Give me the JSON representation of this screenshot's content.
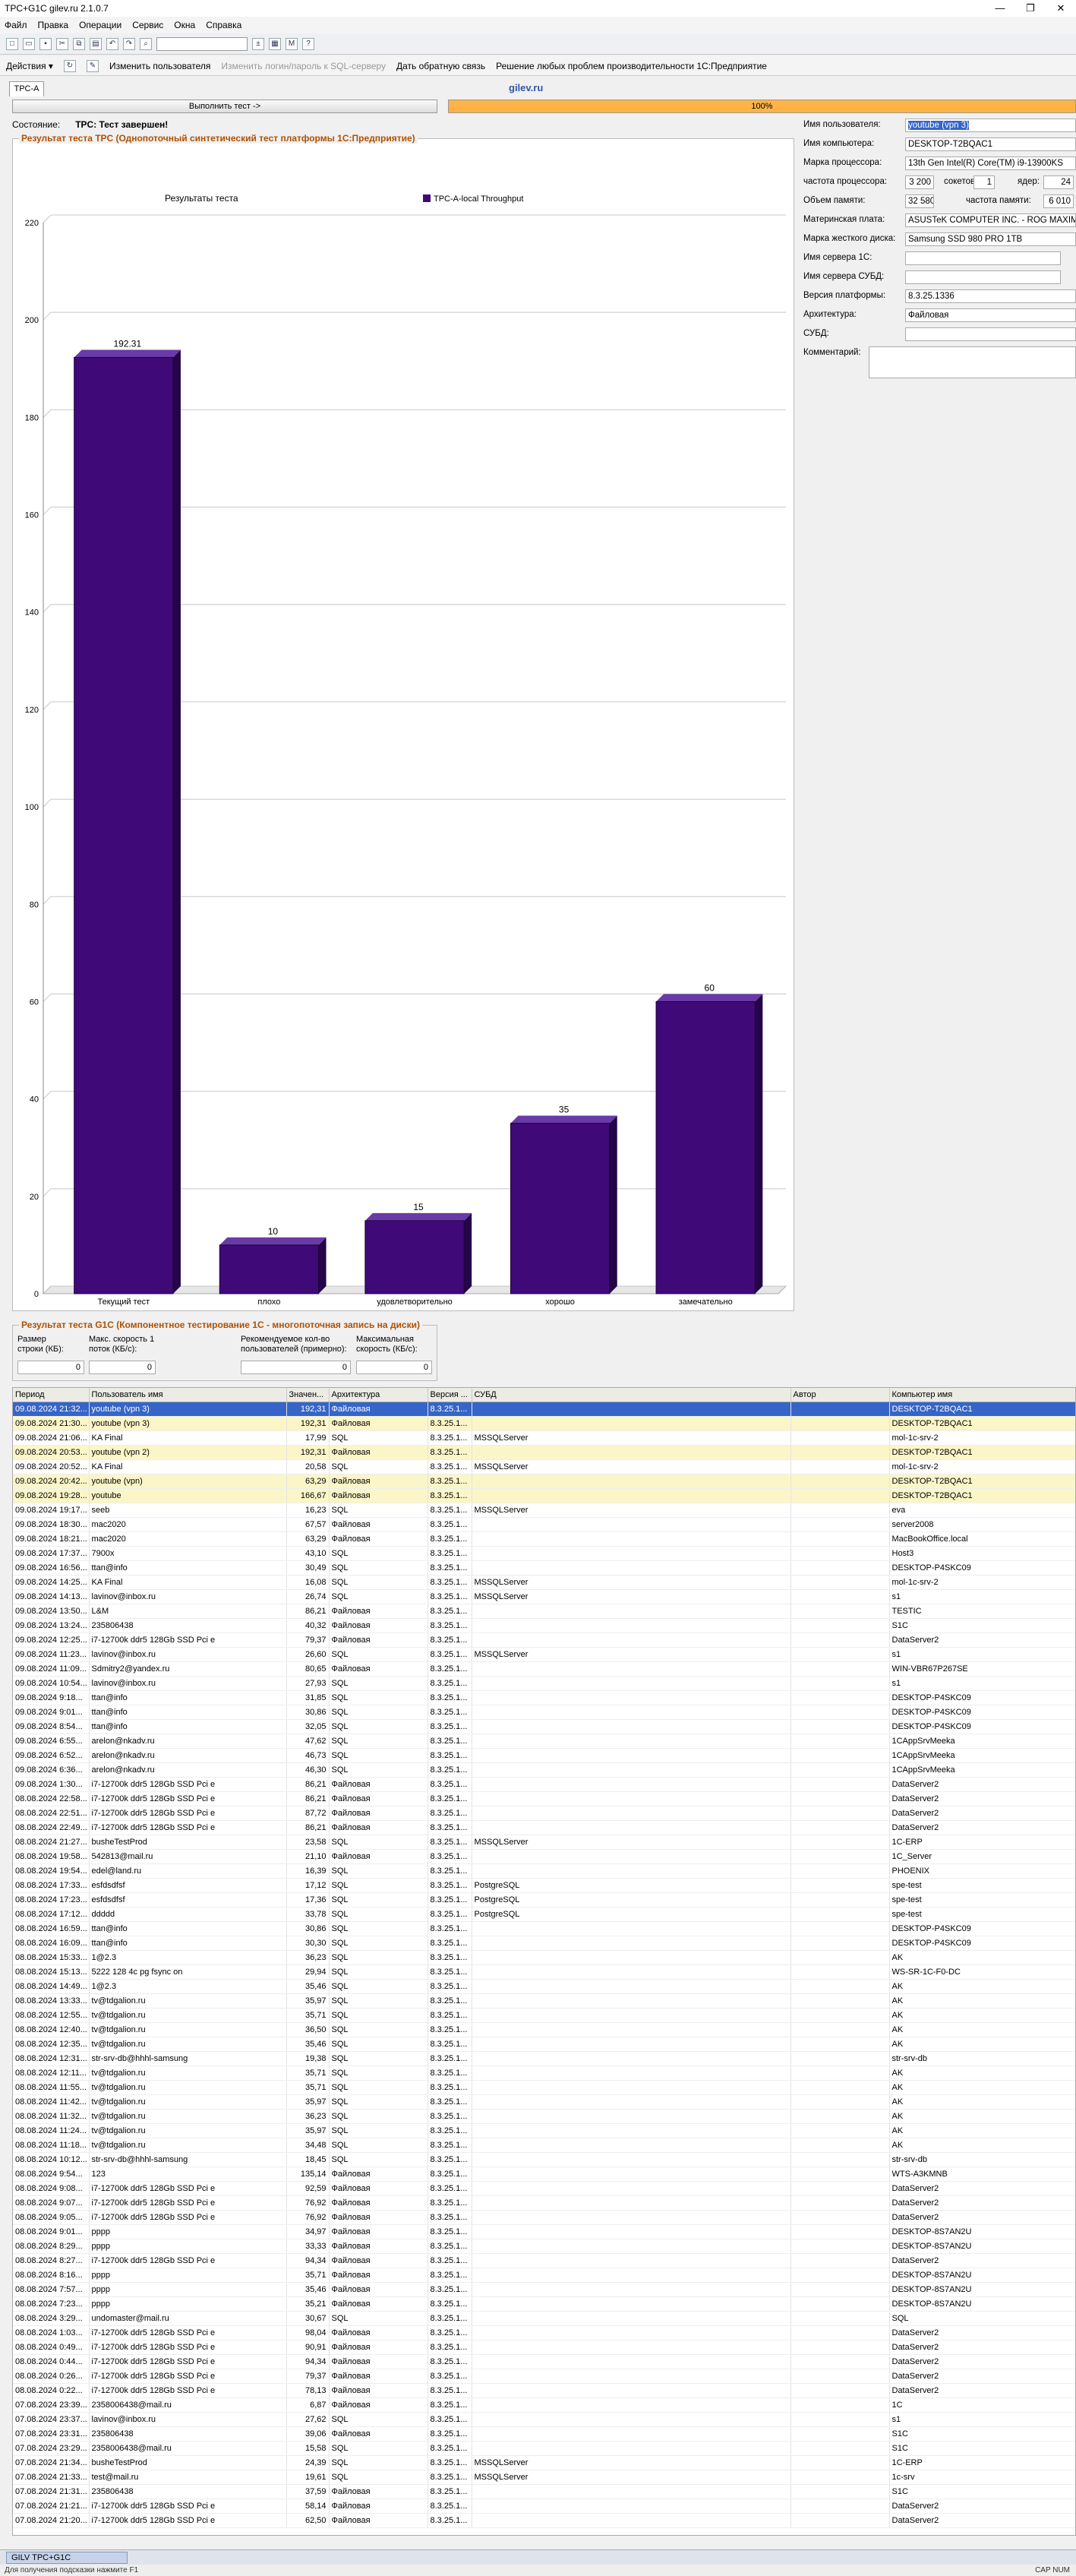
{
  "window": {
    "title": "TPC+G1C gilev.ru 2.1.0.7",
    "controls": [
      "—",
      "❐",
      "✕"
    ]
  },
  "menu": [
    "Файл",
    "Правка",
    "Операции",
    "Сервис",
    "Окна",
    "Справка"
  ],
  "actionbar": {
    "actions": "Действия ▾",
    "change_user": "Изменить пользователя",
    "change_login": "Изменить логин/пароль к SQL-серверу",
    "feedback": "Дать обратную связь",
    "solutions": "Решение любых проблем производительности 1С:Предприятие"
  },
  "tab": "TPC-A",
  "site": "gilev.ru",
  "run_button": "Выполнить тест ->",
  "progress": {
    "value": 100,
    "label": "100%",
    "color": "#ffb347"
  },
  "state": {
    "label": "Состояние:",
    "value": "TPC: Тест завершен!"
  },
  "tpc_group_title": "Результат теста TPC (Однопоточный синтетический тест платформы 1С:Предприятие)",
  "chart_data": {
    "type": "bar",
    "title": "Результаты теста",
    "legend": "TPC-A-local Throughput",
    "categories": [
      "Текущий тест",
      "плохо",
      "удовлетворительно",
      "хорошо",
      "замечательно"
    ],
    "values": [
      192.31,
      10,
      15,
      35,
      60
    ],
    "value_labels": [
      "192.31",
      "10",
      "15",
      "35",
      "60"
    ],
    "ylim": [
      0,
      220
    ],
    "yticks": [
      0,
      20,
      40,
      60,
      80,
      100,
      120,
      140,
      160,
      180,
      200,
      220
    ],
    "grid": true,
    "color": "#3f0a78"
  },
  "right_panel": {
    "user_label": "Имя пользователя:",
    "user_value": "youtube (vpn 3)",
    "computer_label": "Имя компьютера:",
    "computer_value": "DESKTOP-T2BQAC1",
    "cpu_label": "Марка процессора:",
    "cpu_value": "13th Gen Intel(R) Core(TM) i9-13900KS",
    "freq_label": "частота процессора:",
    "freq_value": "3 200",
    "sockets_label": "сокетов:",
    "sockets_value": "1",
    "cores_label": "ядер:",
    "cores_value": "24",
    "mem_label": "Объем памяти:",
    "mem_value": "32 580",
    "memfreq_label": "частота памяти:",
    "memfreq_value": "6 010",
    "mb_label": "Материнская плата:",
    "mb_value": "ASUSTeK COMPUTER INC. - ROG MAXIMUS",
    "disk_label": "Марка жесткого диска:",
    "disk_value": "Samsung SSD 980 PRO 1TB",
    "srv1c_label": "Имя сервера 1С:",
    "srv1c_value": "",
    "srvdb_label": "Имя сервера СУБД:",
    "srvdb_value": "",
    "platform_label": "Версия платформы:",
    "platform_value": "8.3.25.1336",
    "arch_label": "Архитектура:",
    "arch_value": "Файловая",
    "dbms_label": "СУБД:",
    "dbms_value": "",
    "comment_label": "Комментарий:"
  },
  "g1c": {
    "title": "Результат теста G1C (Компонентное тестирование 1С - многопоточная запись на диски)",
    "size_label": "Размер строки (КБ):",
    "size_value": "0",
    "speed_label": "Макс. скорость 1 поток (КБ/с):",
    "speed_value": "0",
    "users_label": "Рекомендуемое кол-во пользователей (примерно):",
    "users_value": "0",
    "maxspeed_label": "Максимальная скорость (КБ/с):",
    "maxspeed_value": "0"
  },
  "grid": {
    "columns": [
      "Период",
      "Пользователь имя",
      "Значен...",
      "Архитектура",
      "Версия ...",
      "СУБД",
      "Автор",
      "Компьютер имя"
    ],
    "rows": [
      [
        "09.08.2024 21:32...",
        "youtube (vpn 3)",
        "192,31",
        "Файловая",
        "8.3.25.1...",
        "",
        "",
        "DESKTOP-T2BQAC1"
      ],
      [
        "09.08.2024 21:30...",
        "youtube (vpn 3)",
        "192,31",
        "Файловая",
        "8.3.25.1...",
        "",
        "",
        "DESKTOP-T2BQAC1"
      ],
      [
        "09.08.2024 21:06...",
        "KA Final",
        "17,99",
        "SQL",
        "8.3.25.1...",
        "MSSQLServer",
        "",
        "mol-1c-srv-2"
      ],
      [
        "09.08.2024 20:53...",
        "youtube (vpn 2)",
        "192,31",
        "Файловая",
        "8.3.25.1...",
        "",
        "",
        "DESKTOP-T2BQAC1"
      ],
      [
        "09.08.2024 20:52...",
        "KA Final",
        "20,58",
        "SQL",
        "8.3.25.1...",
        "MSSQLServer",
        "",
        "mol-1c-srv-2"
      ],
      [
        "09.08.2024 20:42...",
        "youtube (vpn)",
        "63,29",
        "Файловая",
        "8.3.25.1...",
        "",
        "",
        "DESKTOP-T2BQAC1"
      ],
      [
        "09.08.2024 19:28...",
        "youtube",
        "166,67",
        "Файловая",
        "8.3.25.1...",
        "",
        "",
        "DESKTOP-T2BQAC1"
      ],
      [
        "09.08.2024 19:17...",
        "seeb",
        "16,23",
        "SQL",
        "8.3.25.1...",
        "MSSQLServer",
        "",
        "eva"
      ],
      [
        "09.08.2024 18:30...",
        "mac2020",
        "67,57",
        "Файловая",
        "8.3.25.1...",
        "",
        "",
        "server2008"
      ],
      [
        "09.08.2024 18:21...",
        "mac2020",
        "63,29",
        "Файловая",
        "8.3.25.1...",
        "",
        "",
        "MacBookOffice.local"
      ],
      [
        "09.08.2024 17:37...",
        "7900x",
        "43,10",
        "SQL",
        "8.3.25.1...",
        "",
        "",
        "Host3"
      ],
      [
        "09.08.2024 16:56...",
        "ttan@info",
        "30,49",
        "SQL",
        "8.3.25.1...",
        "",
        "",
        "DESKTOP-P4SKC09"
      ],
      [
        "09.08.2024 14:25...",
        "KA Final",
        "16,08",
        "SQL",
        "8.3.25.1...",
        "MSSQLServer",
        "",
        "mol-1c-srv-2"
      ],
      [
        "09.08.2024 14:13...",
        "lavinov@inbox.ru",
        "26,74",
        "SQL",
        "8.3.25.1...",
        "MSSQLServer",
        "",
        "s1"
      ],
      [
        "09.08.2024 13:50...",
        "L&M",
        "86,21",
        "Файловая",
        "8.3.25.1...",
        "",
        "",
        "TESTIC"
      ],
      [
        "09.08.2024 13:24...",
        "235806438",
        "40,32",
        "Файловая",
        "8.3.25.1...",
        "",
        "",
        "S1C"
      ],
      [
        "09.08.2024 12:25...",
        "i7-12700k ddr5 128Gb SSD Pci e",
        "79,37",
        "Файловая",
        "8.3.25.1...",
        "",
        "",
        "DataServer2"
      ],
      [
        "09.08.2024 11:23...",
        "lavinov@inbox.ru",
        "26,60",
        "SQL",
        "8.3.25.1...",
        "MSSQLServer",
        "",
        "s1"
      ],
      [
        "09.08.2024 11:09...",
        "Sdmitry2@yandex.ru",
        "80,65",
        "Файловая",
        "8.3.25.1...",
        "",
        "",
        "WIN-VBR67P267SE"
      ],
      [
        "09.08.2024 10:54...",
        "lavinov@inbox.ru",
        "27,93",
        "SQL",
        "8.3.25.1...",
        "",
        "",
        "s1"
      ],
      [
        "09.08.2024 9:18...",
        "ttan@info",
        "31,85",
        "SQL",
        "8.3.25.1...",
        "",
        "",
        "DESKTOP-P4SKC09"
      ],
      [
        "09.08.2024 9:01...",
        "ttan@info",
        "30,86",
        "SQL",
        "8.3.25.1...",
        "",
        "",
        "DESKTOP-P4SKC09"
      ],
      [
        "09.08.2024 8:54...",
        "ttan@info",
        "32,05",
        "SQL",
        "8.3.25.1...",
        "",
        "",
        "DESKTOP-P4SKC09"
      ],
      [
        "09.08.2024 6:55...",
        "arelon@nkadv.ru",
        "47,62",
        "SQL",
        "8.3.25.1...",
        "",
        "",
        "1CAppSrvMeeka"
      ],
      [
        "09.08.2024 6:52...",
        "arelon@nkadv.ru",
        "46,73",
        "SQL",
        "8.3.25.1...",
        "",
        "",
        "1CAppSrvMeeka"
      ],
      [
        "09.08.2024 6:36...",
        "arelon@nkadv.ru",
        "46,30",
        "SQL",
        "8.3.25.1...",
        "",
        "",
        "1CAppSrvMeeka"
      ],
      [
        "09.08.2024 1:30...",
        "i7-12700k ddr5 128Gb SSD Pci e",
        "86,21",
        "Файловая",
        "8.3.25.1...",
        "",
        "",
        "DataServer2"
      ],
      [
        "08.08.2024 22:58...",
        "i7-12700k ddr5 128Gb SSD Pci e",
        "86,21",
        "Файловая",
        "8.3.25.1...",
        "",
        "",
        "DataServer2"
      ],
      [
        "08.08.2024 22:51...",
        "i7-12700k ddr5 128Gb SSD Pci e",
        "87,72",
        "Файловая",
        "8.3.25.1...",
        "",
        "",
        "DataServer2"
      ],
      [
        "08.08.2024 22:49...",
        "i7-12700k ddr5 128Gb SSD Pci e",
        "86,21",
        "Файловая",
        "8.3.25.1...",
        "",
        "",
        "DataServer2"
      ],
      [
        "08.08.2024 21:27...",
        "busheTestProd",
        "23,58",
        "SQL",
        "8.3.25.1...",
        "MSSQLServer",
        "",
        "1C-ERP"
      ],
      [
        "08.08.2024 19:58...",
        "542813@mail.ru",
        "21,10",
        "Файловая",
        "8.3.25.1...",
        "",
        "",
        "1C_Server"
      ],
      [
        "08.08.2024 19:54...",
        "edel@land.ru",
        "16,39",
        "SQL",
        "8.3.25.1...",
        "",
        "",
        "PHOENIX"
      ],
      [
        "08.08.2024 17:33...",
        "esfdsdfsf",
        "17,12",
        "SQL",
        "8.3.25.1...",
        "PostgreSQL",
        "",
        "spe-test"
      ],
      [
        "08.08.2024 17:23...",
        "esfdsdfsf",
        "17,36",
        "SQL",
        "8.3.25.1...",
        "PostgreSQL",
        "",
        "spe-test"
      ],
      [
        "08.08.2024 17:12...",
        "ddddd",
        "33,78",
        "SQL",
        "8.3.25.1...",
        "PostgreSQL",
        "",
        "spe-test"
      ],
      [
        "08.08.2024 16:59...",
        "ttan@info",
        "30,86",
        "SQL",
        "8.3.25.1...",
        "",
        "",
        "DESKTOP-P4SKC09"
      ],
      [
        "08.08.2024 16:09...",
        "ttan@info",
        "30,30",
        "SQL",
        "8.3.25.1...",
        "",
        "",
        "DESKTOP-P4SKC09"
      ],
      [
        "08.08.2024 15:33...",
        "1@2.3",
        "36,23",
        "SQL",
        "8.3.25.1...",
        "",
        "",
        "AK"
      ],
      [
        "08.08.2024 15:13...",
        "5222 128 4c pg fsync on",
        "29,94",
        "SQL",
        "8.3.25.1...",
        "",
        "",
        "WS-SR-1C-F0-DC"
      ],
      [
        "08.08.2024 14:49...",
        "1@2.3",
        "35,46",
        "SQL",
        "8.3.25.1...",
        "",
        "",
        "AK"
      ],
      [
        "08.08.2024 13:33...",
        "tv@tdgalion.ru",
        "35,97",
        "SQL",
        "8.3.25.1...",
        "",
        "",
        "AK"
      ],
      [
        "08.08.2024 12:55...",
        "tv@tdgalion.ru",
        "35,71",
        "SQL",
        "8.3.25.1...",
        "",
        "",
        "AK"
      ],
      [
        "08.08.2024 12:40...",
        "tv@tdgalion.ru",
        "36,50",
        "SQL",
        "8.3.25.1...",
        "",
        "",
        "AK"
      ],
      [
        "08.08.2024 12:35...",
        "tv@tdgalion.ru",
        "35,46",
        "SQL",
        "8.3.25.1...",
        "",
        "",
        "AK"
      ],
      [
        "08.08.2024 12:31...",
        "str-srv-db@hhhl-samsung",
        "19,38",
        "SQL",
        "8.3.25.1...",
        "",
        "",
        "str-srv-db"
      ],
      [
        "08.08.2024 12:11...",
        "tv@tdgalion.ru",
        "35,71",
        "SQL",
        "8.3.25.1...",
        "",
        "",
        "AK"
      ],
      [
        "08.08.2024 11:55...",
        "tv@tdgalion.ru",
        "35,71",
        "SQL",
        "8.3.25.1...",
        "",
        "",
        "AK"
      ],
      [
        "08.08.2024 11:42...",
        "tv@tdgalion.ru",
        "35,97",
        "SQL",
        "8.3.25.1...",
        "",
        "",
        "AK"
      ],
      [
        "08.08.2024 11:32...",
        "tv@tdgalion.ru",
        "36,23",
        "SQL",
        "8.3.25.1...",
        "",
        "",
        "AK"
      ],
      [
        "08.08.2024 11:24...",
        "tv@tdgalion.ru",
        "35,97",
        "SQL",
        "8.3.25.1...",
        "",
        "",
        "AK"
      ],
      [
        "08.08.2024 11:18...",
        "tv@tdgalion.ru",
        "34,48",
        "SQL",
        "8.3.25.1...",
        "",
        "",
        "AK"
      ],
      [
        "08.08.2024 10:12...",
        "str-srv-db@hhhl-samsung",
        "18,45",
        "SQL",
        "8.3.25.1...",
        "",
        "",
        "str-srv-db"
      ],
      [
        "08.08.2024 9:54...",
        "123",
        "135,14",
        "Файловая",
        "8.3.25.1...",
        "",
        "",
        "WTS-A3KMNB"
      ],
      [
        "08.08.2024 9:08...",
        "i7-12700k ddr5 128Gb SSD Pci e",
        "92,59",
        "Файловая",
        "8.3.25.1...",
        "",
        "",
        "DataServer2"
      ],
      [
        "08.08.2024 9:07...",
        "i7-12700k ddr5 128Gb SSD Pci e",
        "76,92",
        "Файловая",
        "8.3.25.1...",
        "",
        "",
        "DataServer2"
      ],
      [
        "08.08.2024 9:05...",
        "i7-12700k ddr5 128Gb SSD Pci e",
        "76,92",
        "Файловая",
        "8.3.25.1...",
        "",
        "",
        "DataServer2"
      ],
      [
        "08.08.2024 9:01...",
        "pppp",
        "34,97",
        "Файловая",
        "8.3.25.1...",
        "",
        "",
        "DESKTOP-8S7AN2U"
      ],
      [
        "08.08.2024 8:29...",
        "pppp",
        "33,33",
        "Файловая",
        "8.3.25.1...",
        "",
        "",
        "DESKTOP-8S7AN2U"
      ],
      [
        "08.08.2024 8:27...",
        "i7-12700k ddr5 128Gb SSD Pci e",
        "94,34",
        "Файловая",
        "8.3.25.1...",
        "",
        "",
        "DataServer2"
      ],
      [
        "08.08.2024 8:16...",
        "pppp",
        "35,71",
        "Файловая",
        "8.3.25.1...",
        "",
        "",
        "DESKTOP-8S7AN2U"
      ],
      [
        "08.08.2024 7:57...",
        "pppp",
        "35,46",
        "Файловая",
        "8.3.25.1...",
        "",
        "",
        "DESKTOP-8S7AN2U"
      ],
      [
        "08.08.2024 7:23...",
        "pppp",
        "35,21",
        "Файловая",
        "8.3.25.1...",
        "",
        "",
        "DESKTOP-8S7AN2U"
      ],
      [
        "08.08.2024 3:29...",
        "undomaster@mail.ru",
        "30,67",
        "SQL",
        "8.3.25.1...",
        "",
        "",
        "SQL"
      ],
      [
        "08.08.2024 1:03...",
        "i7-12700k ddr5 128Gb SSD Pci e",
        "98,04",
        "Файловая",
        "8.3.25.1...",
        "",
        "",
        "DataServer2"
      ],
      [
        "08.08.2024 0:49...",
        "i7-12700k ddr5 128Gb SSD Pci e",
        "90,91",
        "Файловая",
        "8.3.25.1...",
        "",
        "",
        "DataServer2"
      ],
      [
        "08.08.2024 0:44...",
        "i7-12700k ddr5 128Gb SSD Pci e",
        "94,34",
        "Файловая",
        "8.3.25.1...",
        "",
        "",
        "DataServer2"
      ],
      [
        "08.08.2024 0:26...",
        "i7-12700k ddr5 128Gb SSD Pci e",
        "79,37",
        "Файловая",
        "8.3.25.1...",
        "",
        "",
        "DataServer2"
      ],
      [
        "08.08.2024 0:22...",
        "i7-12700k ddr5 128Gb SSD Pci e",
        "78,13",
        "Файловая",
        "8.3.25.1...",
        "",
        "",
        "DataServer2"
      ],
      [
        "07.08.2024 23:39...",
        "2358006438@mail.ru",
        "6,87",
        "Файловая",
        "8.3.25.1...",
        "",
        "",
        "1C"
      ],
      [
        "07.08.2024 23:37...",
        "lavinov@inbox.ru",
        "27,62",
        "SQL",
        "8.3.25.1...",
        "",
        "",
        "s1"
      ],
      [
        "07.08.2024 23:31...",
        "235806438",
        "39,06",
        "Файловая",
        "8.3.25.1...",
        "",
        "",
        "S1C"
      ],
      [
        "07.08.2024 23:29...",
        "2358006438@mail.ru",
        "15,58",
        "SQL",
        "8.3.25.1...",
        "",
        "",
        "S1C"
      ],
      [
        "07.08.2024 21:34...",
        "busheTestProd",
        "24,39",
        "SQL",
        "8.3.25.1...",
        "MSSQLServer",
        "",
        "1C-ERP"
      ],
      [
        "07.08.2024 21:33...",
        "test@mail.ru",
        "19,61",
        "SQL",
        "8.3.25.1...",
        "MSSQLServer",
        "",
        "1c-srv"
      ],
      [
        "07.08.2024 21:31...",
        "235806438",
        "37,59",
        "Файловая",
        "8.3.25.1...",
        "",
        "",
        "S1C"
      ],
      [
        "07.08.2024 21:21...",
        "i7-12700k ddr5 128Gb SSD Pci e",
        "58,14",
        "Файловая",
        "8.3.25.1...",
        "",
        "",
        "DataServer2"
      ],
      [
        "07.08.2024 21:20...",
        "i7-12700k ddr5 128Gb SSD Pci e",
        "62,50",
        "Файловая",
        "8.3.25.1...",
        "",
        "",
        "DataServer2"
      ]
    ]
  },
  "taskbar": {
    "item": "GILV TPC+G1C"
  },
  "statusbar": {
    "text": "Для получения подсказки нажмите F1",
    "right": "CAP   NUM"
  }
}
